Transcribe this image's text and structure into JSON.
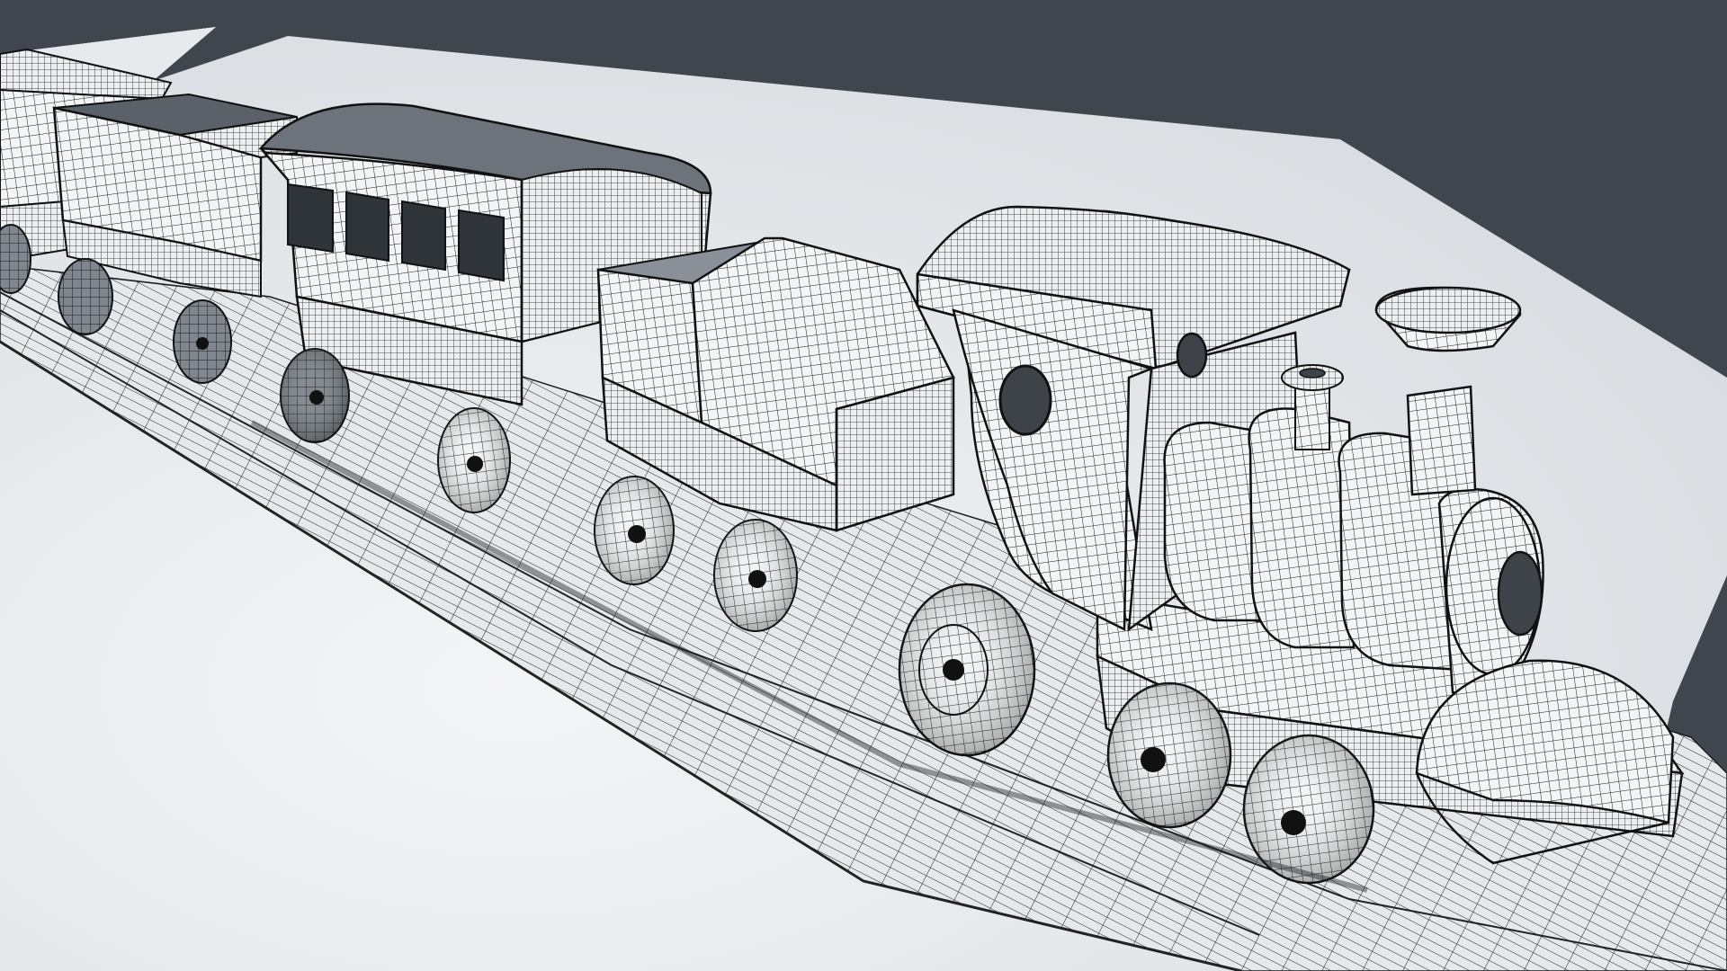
{
  "scene": {
    "subject": "toy-train-wireframe-render",
    "colors": {
      "background": "#3f464d",
      "floor_light": "#eef0f2",
      "floor_mid": "#dde1e5",
      "wire": "#111111",
      "surface": "#f2f3f4",
      "shadow": "#2a2e33"
    }
  }
}
